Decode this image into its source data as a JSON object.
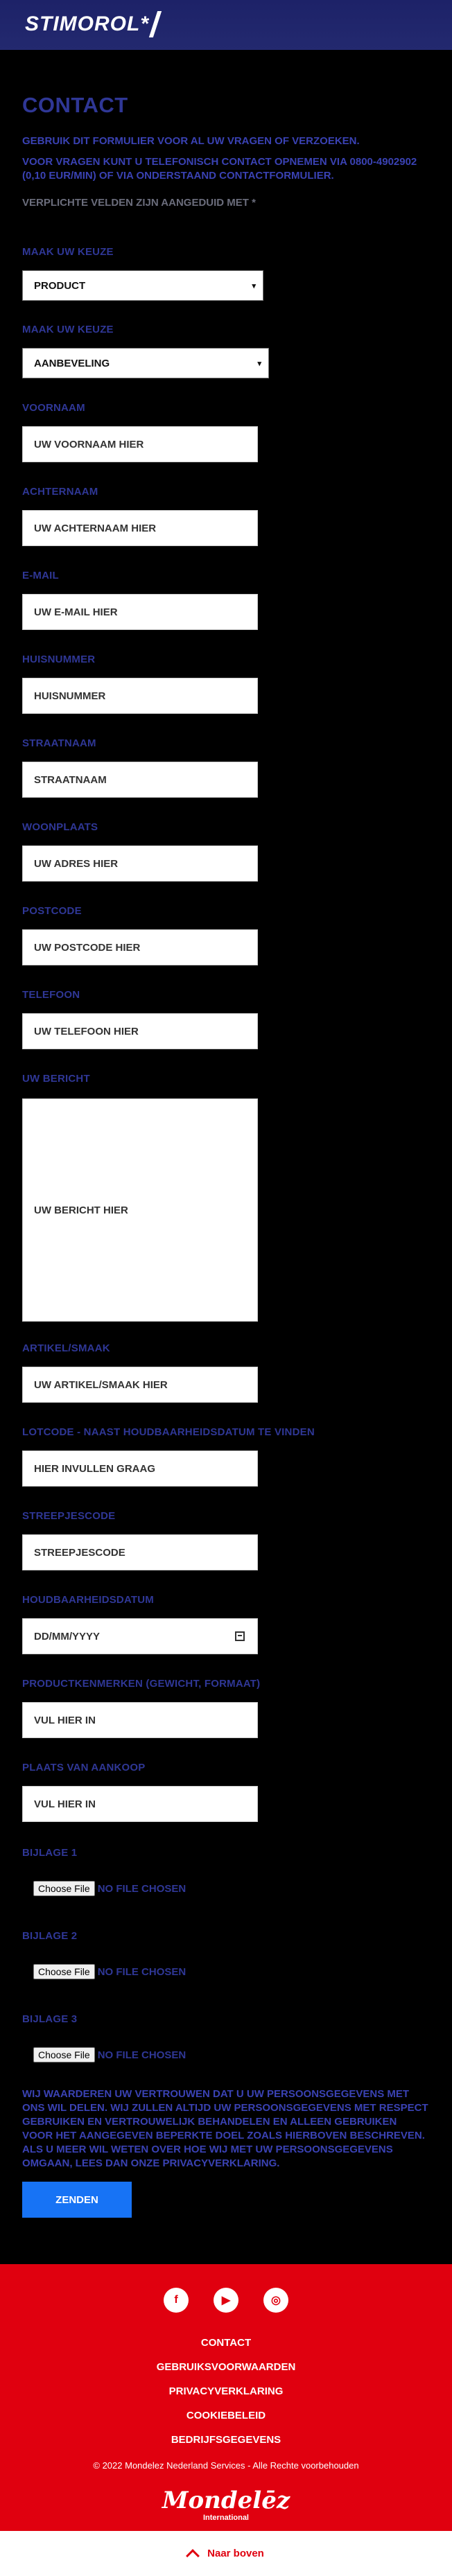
{
  "header": {
    "logo_text": "STIMOROL"
  },
  "page": {
    "title": "CONTACT",
    "intro": "GEBRUIK DIT FORMULIER VOOR AL UW VRAGEN OF VERZOEKEN.",
    "intro2": "VOOR VRAGEN KUNT U TELEFONISCH CONTACT OPNEMEN VIA 0800-4902902 (0,10 EUR/MIN) OF VIA ONDERSTAAND CONTACTFORMULIER.",
    "required_note": "VERPLICHTE VELDEN ZIJN AANGEDUID MET *"
  },
  "form": {
    "select1": {
      "label": "MAAK UW KEUZE",
      "value": "PRODUCT"
    },
    "select2": {
      "label": "MAAK UW KEUZE",
      "value": "AANBEVELING"
    },
    "voornaam": {
      "label": "VOORNAAM",
      "placeholder": "UW VOORNAAM HIER"
    },
    "achternaam": {
      "label": "ACHTERNAAM",
      "placeholder": "UW ACHTERNAAM HIER"
    },
    "email": {
      "label": "E-MAIL",
      "placeholder": "UW E-MAIL HIER"
    },
    "huisnummer": {
      "label": "HUISNUMMER",
      "placeholder": "HUISNUMMER"
    },
    "straatnaam": {
      "label": "STRAATNAAM",
      "placeholder": "STRAATNAAM"
    },
    "woonplaats": {
      "label": "WOONPLAATS",
      "placeholder": "UW ADRES HIER"
    },
    "postcode": {
      "label": "POSTCODE",
      "placeholder": "UW POSTCODE HIER"
    },
    "telefoon": {
      "label": "TELEFOON",
      "placeholder": "UW TELEFOON HIER"
    },
    "bericht": {
      "label": "UW BERICHT",
      "placeholder": "UW BERICHT HIER"
    },
    "artikel": {
      "label": "ARTIKEL/SMAAK",
      "placeholder": "UW ARTIKEL/SMAAK HIER"
    },
    "lotcode": {
      "label": "LOTCODE - NAAST HOUDBAARHEIDSDATUM TE VINDEN",
      "placeholder": "HIER INVULLEN GRAAG"
    },
    "streepjescode": {
      "label": "STREEPJESCODE",
      "placeholder": "STREEPJESCODE"
    },
    "houdbaarheid": {
      "label": "HOUDBAARHEIDSDATUM",
      "placeholder": "DD/MM/YYYY"
    },
    "productkenmerken": {
      "label": "PRODUCTKENMERKEN (GEWICHT, FORMAAT)",
      "placeholder": "VUL HIER IN"
    },
    "aankoop": {
      "label": "PLAATS VAN AANKOOP",
      "placeholder": "VUL HIER IN"
    },
    "bijlage1": {
      "label": "BIJLAGE 1",
      "button": "Choose File",
      "status": "NO FILE CHOSEN"
    },
    "bijlage2": {
      "label": "BIJLAGE 2",
      "button": "Choose File",
      "status": "NO FILE CHOSEN"
    },
    "bijlage3": {
      "label": "BIJLAGE 3",
      "button": "Choose File",
      "status": "NO FILE CHOSEN"
    },
    "privacy": "WIJ WAARDEREN UW VERTROUWEN DAT U UW PERSOONSGEGEVENS MET ONS WIL DELEN. WIJ ZULLEN ALTIJD UW PERSOONSGEGEVENS MET RESPECT GEBRUIKEN EN VERTROUWELIJK BEHANDELEN EN ALLEEN GEBRUIKEN VOOR HET AANGEGEVEN BEPERKTE DOEL ZOALS HIERBOVEN BESCHREVEN. ALS U MEER WIL WETEN OVER HOE WIJ MET UW PERSOONSGEGEVENS OMGAAN, LEES DAN ONZE PRIVACYVERKLARING.",
    "submit": "ZENDEN"
  },
  "footer": {
    "social": {
      "facebook": "f",
      "youtube": "▶",
      "instagram": "◎"
    },
    "links": [
      "CONTACT",
      "GEBRUIKSVOORWAARDEN",
      "PRIVACYVERKLARING",
      "COOKIEBELEID",
      "BEDRIJFSGEGEVENS"
    ],
    "copyright": "© 2022 Mondelez Nederland Services - Alle Rechte voorbehouden",
    "brand": "Mondelēz",
    "brand_sub": "International",
    "back_to_top": "Naar boven"
  },
  "colors": {
    "brand_blue": "#2f3796",
    "footer_red": "#e0000f",
    "button_blue": "#1773f5"
  }
}
